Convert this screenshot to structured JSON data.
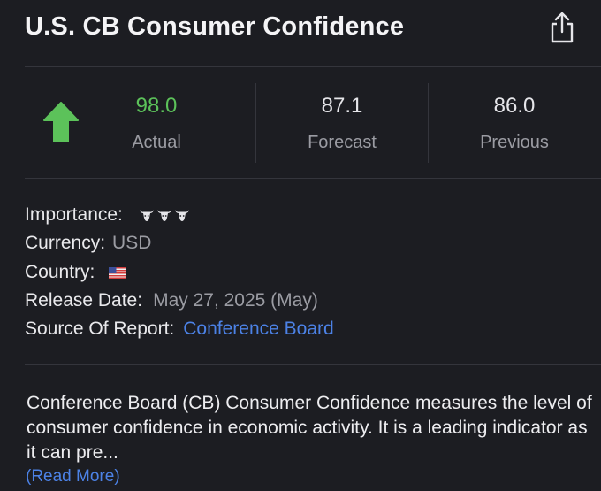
{
  "header": {
    "title": "U.S. CB Consumer Confidence",
    "share_icon": "share-icon"
  },
  "stats": {
    "trend_icon": "arrow-up-icon",
    "actual": {
      "value": "98.0",
      "label": "Actual"
    },
    "forecast": {
      "value": "87.1",
      "label": "Forecast"
    },
    "previous": {
      "value": "86.0",
      "label": "Previous"
    }
  },
  "details": {
    "importance": {
      "label": "Importance:",
      "icon": "bull-icon",
      "level": 3
    },
    "currency": {
      "label": "Currency:",
      "value": "USD"
    },
    "country": {
      "label": "Country:",
      "flag_icon": "us-flag-icon"
    },
    "release_date": {
      "label": "Release Date:",
      "value": "May 27, 2025 (May)"
    },
    "source": {
      "label": "Source Of Report:",
      "value": "Conference Board"
    }
  },
  "description": {
    "text": "Conference Board (CB) Consumer Confidence measures the level of consumer confidence in economic activity. It is a leading indicator as it can pre...",
    "read_more": "(Read More)"
  },
  "colors": {
    "background": "#1c1d22",
    "actual_green": "#5cc25a",
    "link_blue": "#4c82e6",
    "muted_text": "#9b9ca3"
  }
}
